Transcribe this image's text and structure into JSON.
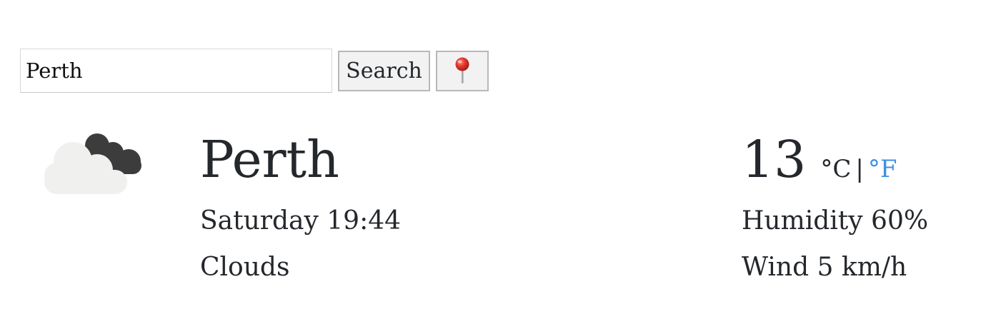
{
  "search": {
    "value": "Perth",
    "button_label": "Search",
    "locate_icon": "pushpin-icon"
  },
  "weather": {
    "icon": "clouds-icon",
    "city": "Perth",
    "datetime": "Saturday 19:44",
    "condition": "Clouds",
    "temperature": "13",
    "unit_celsius": "°C",
    "unit_separator": "|",
    "unit_fahrenheit": "°F",
    "humidity": "Humidity 60%",
    "wind": "Wind 5 km/h"
  },
  "colors": {
    "text": "#24272b",
    "link": "#3d8fe6",
    "cloud_light": "#f0f0ef",
    "cloud_dark": "#3c3c3c",
    "pin_red": "#d9322b"
  }
}
